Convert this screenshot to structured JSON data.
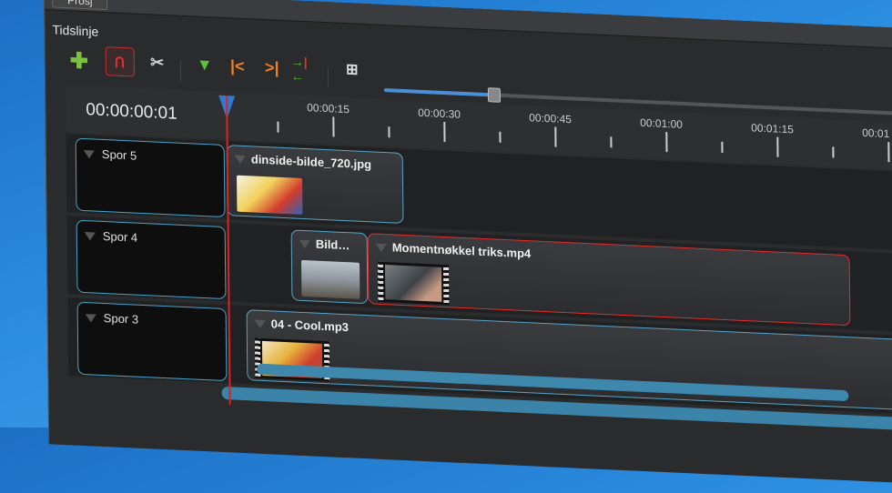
{
  "topbar": {
    "project_button": "Prosj"
  },
  "panel": {
    "title": "Tidslinje"
  },
  "toolbar": {
    "buttons": [
      {
        "name": "add-track",
        "icon": "plus-icon",
        "glyph": "✚",
        "color": "#7cc242"
      },
      {
        "name": "snap",
        "icon": "magnet-icon",
        "glyph": "⊂",
        "color": "#e03030"
      },
      {
        "name": "razor",
        "icon": "scissors-icon",
        "glyph": "✂",
        "color": "#d8d8d8"
      },
      {
        "name": "add-marker",
        "icon": "marker-icon",
        "glyph": "▼",
        "color": "#5cbf3a"
      },
      {
        "name": "previous-marker",
        "icon": "previous-marker-icon",
        "glyph": "|<",
        "color": "#f08020"
      },
      {
        "name": "next-marker",
        "icon": "next-marker-icon",
        "glyph": ">|",
        "color": "#f08020"
      },
      {
        "name": "center-playhead",
        "icon": "center-icon",
        "glyph": "⇥⇤",
        "color": "#e03030"
      },
      {
        "name": "zoom",
        "icon": "zoom-icon",
        "glyph": "⊞",
        "color": "#dddddd"
      }
    ],
    "zoom_level": 0.2
  },
  "timeline": {
    "current_time": "00:00:00:01",
    "ruler_labels": [
      "00:00:15",
      "00:00:30",
      "00:00:45",
      "00:01:00",
      "00:01:15",
      "00:01"
    ]
  },
  "tracks": [
    {
      "name": "Spor 5",
      "clips": [
        {
          "title": "dinside-bilde_720.jpg",
          "kind": "image",
          "selected": false
        }
      ]
    },
    {
      "name": "Spor 4",
      "clips": [
        {
          "title": "Bild…",
          "kind": "image",
          "selected": false
        },
        {
          "title": "Momentnøkkel triks.mp4",
          "kind": "video",
          "selected": true
        }
      ]
    },
    {
      "name": "Spor 3",
      "clips": [
        {
          "title": "04 - Cool.mp3",
          "kind": "audio",
          "selected": false
        }
      ]
    }
  ]
}
